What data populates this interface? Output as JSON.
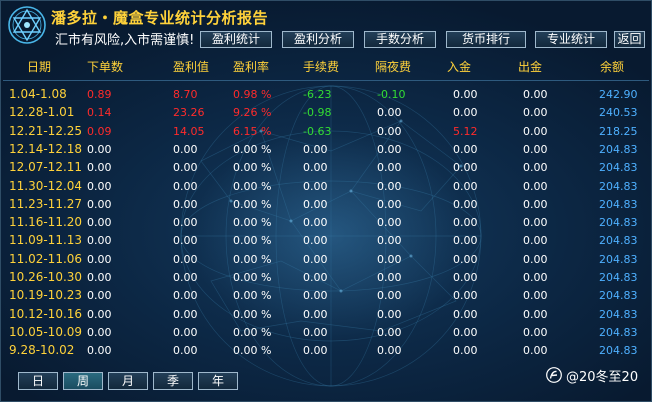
{
  "header": {
    "title": "潘多拉・魔盒专业统计分析报告",
    "risk_notice": "汇市有风险,入市需谨慎!"
  },
  "nav": [
    {
      "label": "盈利统计"
    },
    {
      "label": "盈利分析"
    },
    {
      "label": "手数分析"
    },
    {
      "label": "货币排行"
    },
    {
      "label": "专业统计"
    },
    {
      "label": "返回"
    }
  ],
  "columns": [
    "日期",
    "下单数",
    "盈利值",
    "盈利率",
    "手续费",
    "隔夜费",
    "入金",
    "出金",
    "余额"
  ],
  "colors": {
    "date": "#ffd23a",
    "header": "#ffd23a",
    "positive": "#ff2b2b",
    "negative": "#33dd33",
    "neutral": "#ffffff",
    "balance": "#4eb0ff"
  },
  "rows": [
    {
      "date": "1.04-1.08",
      "orders": "0.89",
      "profit": "8.70",
      "rate": "0.98 %",
      "fee": "-6.23",
      "overnight": "-0.10",
      "deposit": "0.00",
      "withdraw": "0.00",
      "balance": "242.90"
    },
    {
      "date": "12.28-1.01",
      "orders": "0.14",
      "profit": "23.26",
      "rate": "9.26 %",
      "fee": "-0.98",
      "overnight": "0.00",
      "deposit": "0.00",
      "withdraw": "0.00",
      "balance": "240.53"
    },
    {
      "date": "12.21-12.25",
      "orders": "0.09",
      "profit": "14.05",
      "rate": "6.15 %",
      "fee": "-0.63",
      "overnight": "0.00",
      "deposit": "5.12",
      "withdraw": "0.00",
      "balance": "218.25"
    },
    {
      "date": "12.14-12.18",
      "orders": "0.00",
      "profit": "0.00",
      "rate": "0.00 %",
      "fee": "0.00",
      "overnight": "0.00",
      "deposit": "0.00",
      "withdraw": "0.00",
      "balance": "204.83"
    },
    {
      "date": "12.07-12.11",
      "orders": "0.00",
      "profit": "0.00",
      "rate": "0.00 %",
      "fee": "0.00",
      "overnight": "0.00",
      "deposit": "0.00",
      "withdraw": "0.00",
      "balance": "204.83"
    },
    {
      "date": "11.30-12.04",
      "orders": "0.00",
      "profit": "0.00",
      "rate": "0.00 %",
      "fee": "0.00",
      "overnight": "0.00",
      "deposit": "0.00",
      "withdraw": "0.00",
      "balance": "204.83"
    },
    {
      "date": "11.23-11.27",
      "orders": "0.00",
      "profit": "0.00",
      "rate": "0.00 %",
      "fee": "0.00",
      "overnight": "0.00",
      "deposit": "0.00",
      "withdraw": "0.00",
      "balance": "204.83"
    },
    {
      "date": "11.16-11.20",
      "orders": "0.00",
      "profit": "0.00",
      "rate": "0.00 %",
      "fee": "0.00",
      "overnight": "0.00",
      "deposit": "0.00",
      "withdraw": "0.00",
      "balance": "204.83"
    },
    {
      "date": "11.09-11.13",
      "orders": "0.00",
      "profit": "0.00",
      "rate": "0.00 %",
      "fee": "0.00",
      "overnight": "0.00",
      "deposit": "0.00",
      "withdraw": "0.00",
      "balance": "204.83"
    },
    {
      "date": "11.02-11.06",
      "orders": "0.00",
      "profit": "0.00",
      "rate": "0.00 %",
      "fee": "0.00",
      "overnight": "0.00",
      "deposit": "0.00",
      "withdraw": "0.00",
      "balance": "204.83"
    },
    {
      "date": "10.26-10.30",
      "orders": "0.00",
      "profit": "0.00",
      "rate": "0.00 %",
      "fee": "0.00",
      "overnight": "0.00",
      "deposit": "0.00",
      "withdraw": "0.00",
      "balance": "204.83"
    },
    {
      "date": "10.19-10.23",
      "orders": "0.00",
      "profit": "0.00",
      "rate": "0.00 %",
      "fee": "0.00",
      "overnight": "0.00",
      "deposit": "0.00",
      "withdraw": "0.00",
      "balance": "204.83"
    },
    {
      "date": "10.12-10.16",
      "orders": "0.00",
      "profit": "0.00",
      "rate": "0.00 %",
      "fee": "0.00",
      "overnight": "0.00",
      "deposit": "0.00",
      "withdraw": "0.00",
      "balance": "204.83"
    },
    {
      "date": "10.05-10.09",
      "orders": "0.00",
      "profit": "0.00",
      "rate": "0.00 %",
      "fee": "0.00",
      "overnight": "0.00",
      "deposit": "0.00",
      "withdraw": "0.00",
      "balance": "204.83"
    },
    {
      "date": "9.28-10.02",
      "orders": "0.00",
      "profit": "0.00",
      "rate": "0.00 %",
      "fee": "0.00",
      "overnight": "0.00",
      "deposit": "0.00",
      "withdraw": "0.00",
      "balance": "204.83"
    }
  ],
  "periods": [
    {
      "label": "日"
    },
    {
      "label": "周",
      "active": true
    },
    {
      "label": "月"
    },
    {
      "label": "季"
    },
    {
      "label": "年"
    }
  ],
  "watermark": {
    "text": "@20冬至20",
    "icon": "brand-logo-icon"
  }
}
